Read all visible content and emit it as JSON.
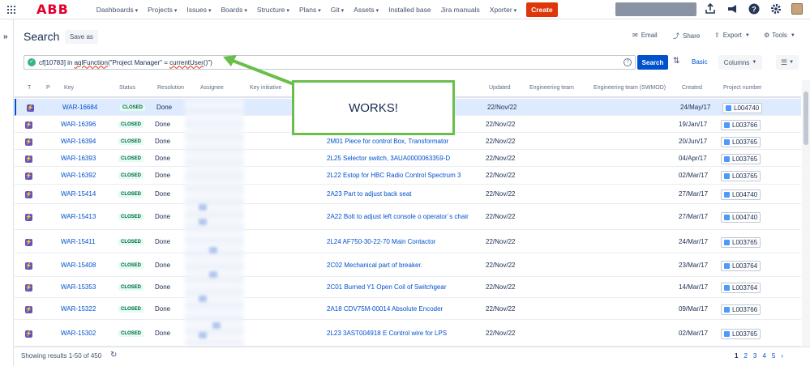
{
  "topbar": {
    "logo": "ABB",
    "nav": [
      "Dashboards",
      "Projects",
      "Issues",
      "Boards",
      "Structure",
      "Plans",
      "Git",
      "Assets",
      "Installed base",
      "Jira manuals",
      "Xporter"
    ],
    "nav_has_caret": [
      true,
      true,
      true,
      true,
      true,
      true,
      true,
      true,
      false,
      false,
      true
    ],
    "create_label": "Create"
  },
  "page": {
    "title": "Search",
    "save_as": "Save as",
    "email": "Email",
    "share": "Share",
    "export": "Export",
    "tools": "Tools"
  },
  "query": {
    "prefix": "cf[10783] in ",
    "fn": "aqlFunction",
    "middle": "(\"Project Manager\" = ",
    "user_fn": "currentUser",
    "suffix": "()\")",
    "search_label": "Search",
    "basic_label": "Basic",
    "columns_label": "Columns"
  },
  "table": {
    "headers": [
      "T",
      "P",
      "Key",
      "Status",
      "Resolution",
      "Assignee",
      "Key initiative",
      "Updated",
      "Engineering team",
      "Engineering team (SWMOD)",
      "Created",
      "Project number"
    ],
    "rows": [
      {
        "key": "WAR-16684",
        "status": "CLOSED",
        "resolution": "Done",
        "summary": "",
        "updated": "22/Nov/22",
        "created": "24/May/17",
        "project": "L004740"
      },
      {
        "key": "WAR-16396",
        "status": "CLOSED",
        "resolution": "Done",
        "summary": "",
        "updated": "22/Nov/22",
        "created": "19/Jan/17",
        "project": "L003766"
      },
      {
        "key": "WAR-16394",
        "status": "CLOSED",
        "resolution": "Done",
        "summary": "2M01 Piece for control Box, Transformator",
        "updated": "22/Nov/22",
        "created": "20/Jun/17",
        "project": "L003765"
      },
      {
        "key": "WAR-16393",
        "status": "CLOSED",
        "resolution": "Done",
        "summary": "2L25 Selector switch, 3AUA0000063359-D",
        "updated": "22/Nov/22",
        "created": "04/Apr/17",
        "project": "L003765"
      },
      {
        "key": "WAR-16392",
        "status": "CLOSED",
        "resolution": "Done",
        "summary": "2L22 Estop for HBC Radio Control Spectrum 3",
        "updated": "22/Nov/22",
        "created": "02/Mar/17",
        "project": "L003765"
      },
      {
        "key": "WAR-15414",
        "status": "CLOSED",
        "resolution": "Done",
        "summary": "2A23 Part to adjust back seat",
        "updated": "22/Nov/22",
        "created": "27/Mar/17",
        "project": "L004740"
      },
      {
        "key": "WAR-15413",
        "status": "CLOSED",
        "resolution": "Done",
        "summary": "2A22 Bolt to adjust left console o operator´s chair",
        "updated": "22/Nov/22",
        "created": "27/Mar/17",
        "project": "L004740"
      },
      {
        "key": "WAR-15411",
        "status": "CLOSED",
        "resolution": "Done",
        "summary": "2L24 AF750-30-22-70 Main Contactor",
        "updated": "22/Nov/22",
        "created": "24/Mar/17",
        "project": "L003765"
      },
      {
        "key": "WAR-15408",
        "status": "CLOSED",
        "resolution": "Done",
        "summary": "2C02 Mechanical part of breaker.",
        "updated": "22/Nov/22",
        "created": "23/Mar/17",
        "project": "L003764"
      },
      {
        "key": "WAR-15353",
        "status": "CLOSED",
        "resolution": "Done",
        "summary": "2C01 Burned Y1 Open Coil of Switchgear",
        "updated": "22/Nov/22",
        "created": "14/Mar/17",
        "project": "L003764"
      },
      {
        "key": "WAR-15322",
        "status": "CLOSED",
        "resolution": "Done",
        "summary": "2A18 CDV75M-00014 Absolute Encoder",
        "updated": "22/Nov/22",
        "created": "09/Mar/17",
        "project": "L003766"
      },
      {
        "key": "WAR-15302",
        "status": "CLOSED",
        "resolution": "Done",
        "summary": "2L23 3AST004918 E Control wire for LPS",
        "updated": "22/Nov/22",
        "created": "02/Mar/17",
        "project": "L003765"
      }
    ]
  },
  "callout": "WORKS!",
  "footer": {
    "showing": "Showing results 1-50 of 450",
    "pages": [
      "1",
      "2",
      "3",
      "4",
      "5"
    ],
    "current_page": "1"
  }
}
